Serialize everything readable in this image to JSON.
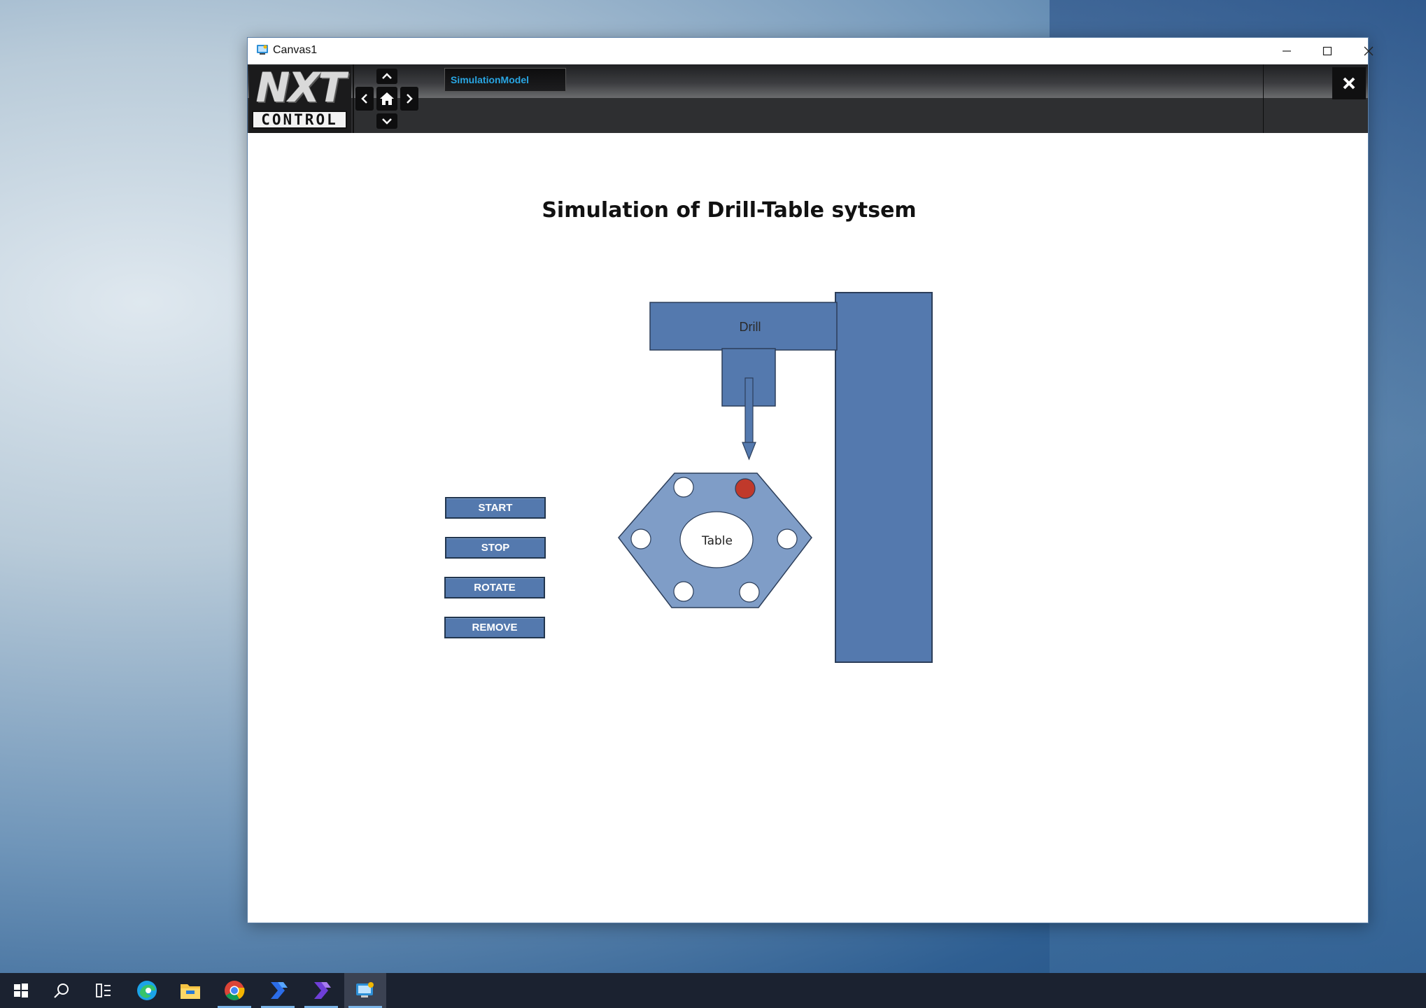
{
  "window": {
    "title": "Canvas1",
    "minimize_icon": "minimize-icon",
    "maximize_icon": "maximize-icon",
    "close_icon": "close-icon"
  },
  "toolbar": {
    "logo_top": "NXT",
    "logo_bottom": "CONTROL",
    "nav": {
      "up_icon": "chevron-up-icon",
      "down_icon": "chevron-down-icon",
      "left_icon": "chevron-left-icon",
      "right_icon": "chevron-right-icon",
      "home_icon": "home-icon"
    },
    "active_tab": "SimulationModel",
    "close_icon": "close-icon",
    "tab_color": "#29a6e3"
  },
  "canvas": {
    "title": "Simulation of Drill-Table sytsem",
    "buttons": [
      "START",
      "STOP",
      "ROTATE",
      "REMOVE"
    ],
    "drill_label": "Drill",
    "table_label": "Table",
    "shape_color": "#5479ae",
    "table_color": "#7f9dc7",
    "active_slot_color": "#c0392b"
  },
  "taskbar": {
    "items": [
      "start-icon",
      "search-icon",
      "task-view-icon",
      "edge-icon",
      "file-explorer-icon",
      "chrome-icon",
      "power-automate-icon",
      "power-automate-icon",
      "canvas-app-icon"
    ]
  }
}
